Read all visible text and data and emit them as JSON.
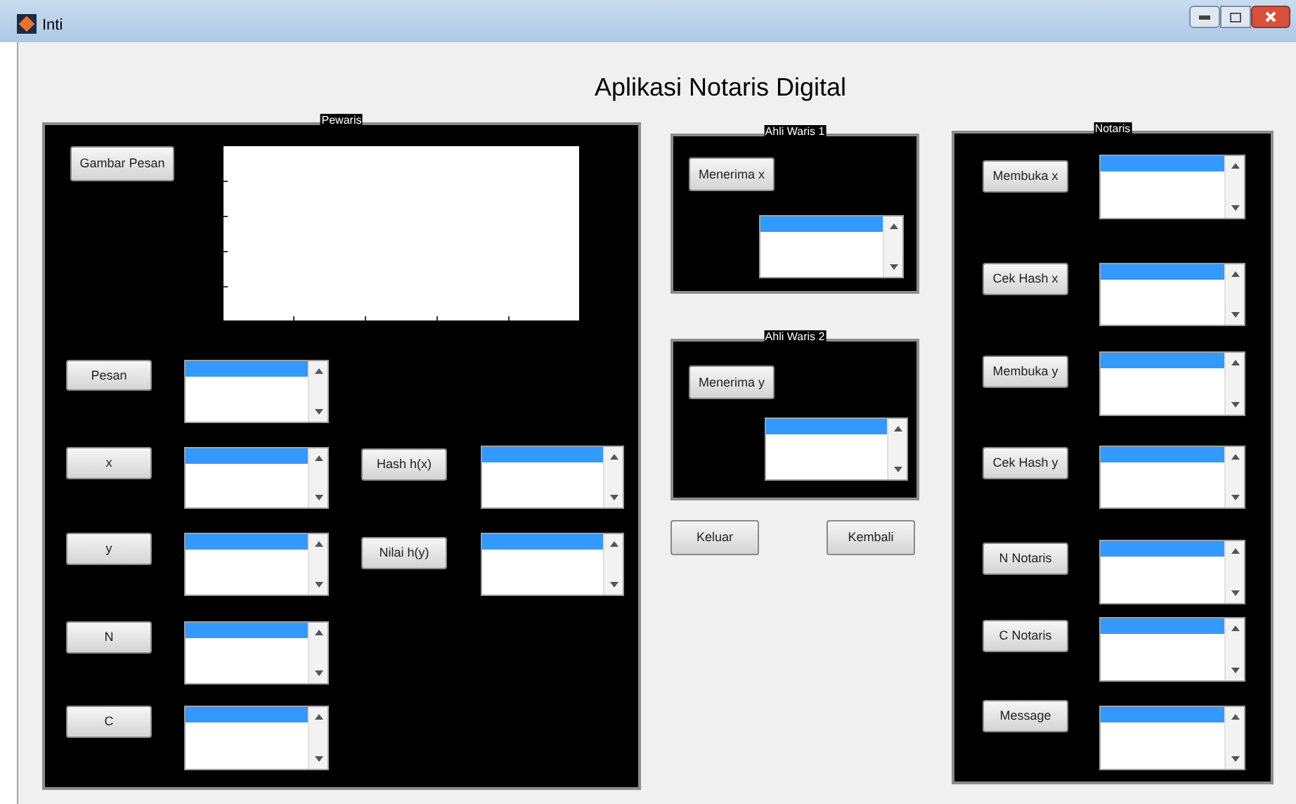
{
  "window": {
    "title": "Inti"
  },
  "heading": "Aplikasi Notaris Digital",
  "panels": [
    {
      "title": "Pewaris",
      "items": [
        {
          "kind": "button",
          "label": "Gambar Pesan"
        },
        {
          "kind": "axes"
        },
        {
          "kind": "button",
          "label": "Pesan"
        },
        {
          "kind": "listbox"
        },
        {
          "kind": "button",
          "label": "x"
        },
        {
          "kind": "listbox"
        },
        {
          "kind": "button",
          "label": "y"
        },
        {
          "kind": "listbox"
        },
        {
          "kind": "button",
          "label": "N"
        },
        {
          "kind": "listbox"
        },
        {
          "kind": "button",
          "label": "C"
        },
        {
          "kind": "listbox"
        },
        {
          "kind": "button",
          "label": "Hash h(x)"
        },
        {
          "kind": "listbox"
        },
        {
          "kind": "button",
          "label": "Nilai h(y)"
        },
        {
          "kind": "listbox"
        }
      ]
    },
    {
      "title": "Ahli Waris 1",
      "items": [
        {
          "kind": "button",
          "label": "Menerima x"
        },
        {
          "kind": "listbox"
        }
      ]
    },
    {
      "title": "Ahli Waris 2",
      "items": [
        {
          "kind": "button",
          "label": "Menerima y"
        },
        {
          "kind": "listbox"
        }
      ]
    },
    {
      "title": "Notaris",
      "items": [
        {
          "kind": "button",
          "label": "Membuka x"
        },
        {
          "kind": "listbox"
        },
        {
          "kind": "button",
          "label": "Cek Hash x"
        },
        {
          "kind": "listbox"
        },
        {
          "kind": "button",
          "label": "Membuka y"
        },
        {
          "kind": "listbox"
        },
        {
          "kind": "button",
          "label": "Cek Hash y"
        },
        {
          "kind": "listbox"
        },
        {
          "kind": "button",
          "label": "N Notaris"
        },
        {
          "kind": "listbox"
        },
        {
          "kind": "button",
          "label": "C Notaris"
        },
        {
          "kind": "listbox"
        },
        {
          "kind": "button",
          "label": "Message"
        },
        {
          "kind": "listbox"
        }
      ]
    }
  ],
  "buttons": [
    {
      "label": "Keluar"
    },
    {
      "label": "Kembali"
    }
  ]
}
